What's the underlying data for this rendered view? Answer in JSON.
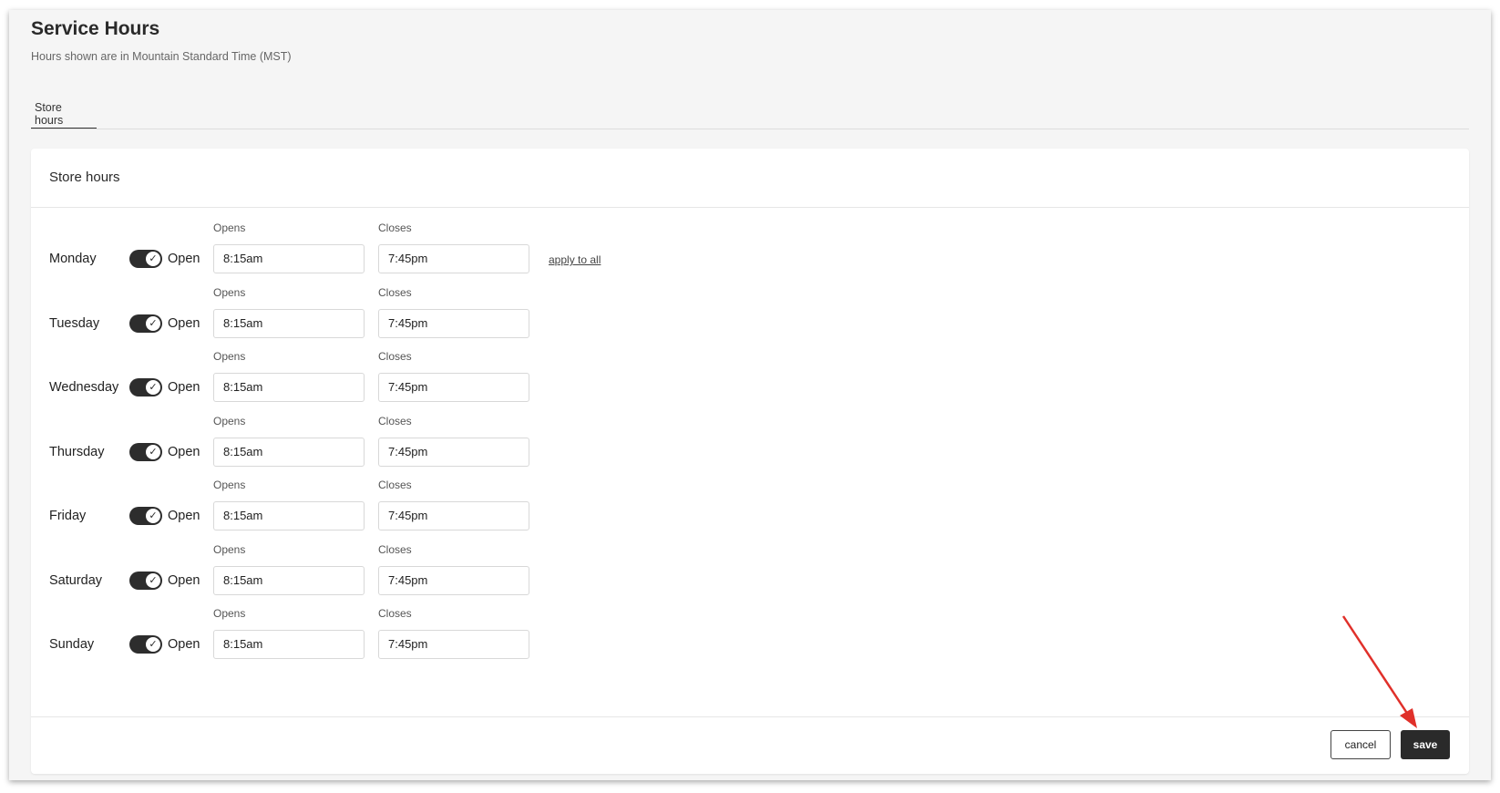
{
  "header": {
    "title": "Service Hours",
    "subtitle": "Hours shown are in Mountain Standard Time (MST)"
  },
  "tabs": [
    {
      "label": "Store hours",
      "active": true
    }
  ],
  "card": {
    "title": "Store hours",
    "opens_label": "Opens",
    "closes_label": "Closes",
    "status_label": "Open",
    "apply_to_all": "apply to all",
    "days": [
      {
        "day": "Monday",
        "open": true,
        "opens": "8:15am",
        "closes": "7:45pm"
      },
      {
        "day": "Tuesday",
        "open": true,
        "opens": "8:15am",
        "closes": "7:45pm"
      },
      {
        "day": "Wednesday",
        "open": true,
        "opens": "8:15am",
        "closes": "7:45pm"
      },
      {
        "day": "Thursday",
        "open": true,
        "opens": "8:15am",
        "closes": "7:45pm"
      },
      {
        "day": "Friday",
        "open": true,
        "opens": "8:15am",
        "closes": "7:45pm"
      },
      {
        "day": "Saturday",
        "open": true,
        "opens": "8:15am",
        "closes": "7:45pm"
      },
      {
        "day": "Sunday",
        "open": true,
        "opens": "8:15am",
        "closes": "7:45pm"
      }
    ]
  },
  "footer": {
    "cancel_label": "cancel",
    "save_label": "save"
  },
  "annotation": {
    "arrow_color": "#e0302a",
    "icon": "arrow-pointer-icon"
  },
  "colors": {
    "accent": "#2a2a2a",
    "background": "#f5f5f5"
  }
}
